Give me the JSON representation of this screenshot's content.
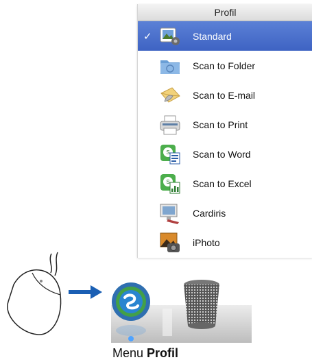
{
  "menu": {
    "title": "Profil",
    "items": [
      {
        "label": "Standard",
        "icon": "standard-profile-icon",
        "selected": true
      },
      {
        "label": "Scan to Folder",
        "icon": "folder-icon"
      },
      {
        "label": "Scan to E-mail",
        "icon": "email-icon"
      },
      {
        "label": "Scan to Print",
        "icon": "printer-icon"
      },
      {
        "label": "Scan to Word",
        "icon": "word-icon"
      },
      {
        "label": "Scan to Excel",
        "icon": "excel-icon"
      },
      {
        "label": "Cardiris",
        "icon": "cardiris-icon"
      },
      {
        "label": "iPhoto",
        "icon": "iphoto-icon"
      }
    ],
    "check_mark": "✓",
    "selected_color": "#4a6fcf"
  },
  "caption": {
    "prefix": "Menu ",
    "bold": "Profil"
  },
  "colors": {
    "arrow": "#1a5fb4"
  }
}
